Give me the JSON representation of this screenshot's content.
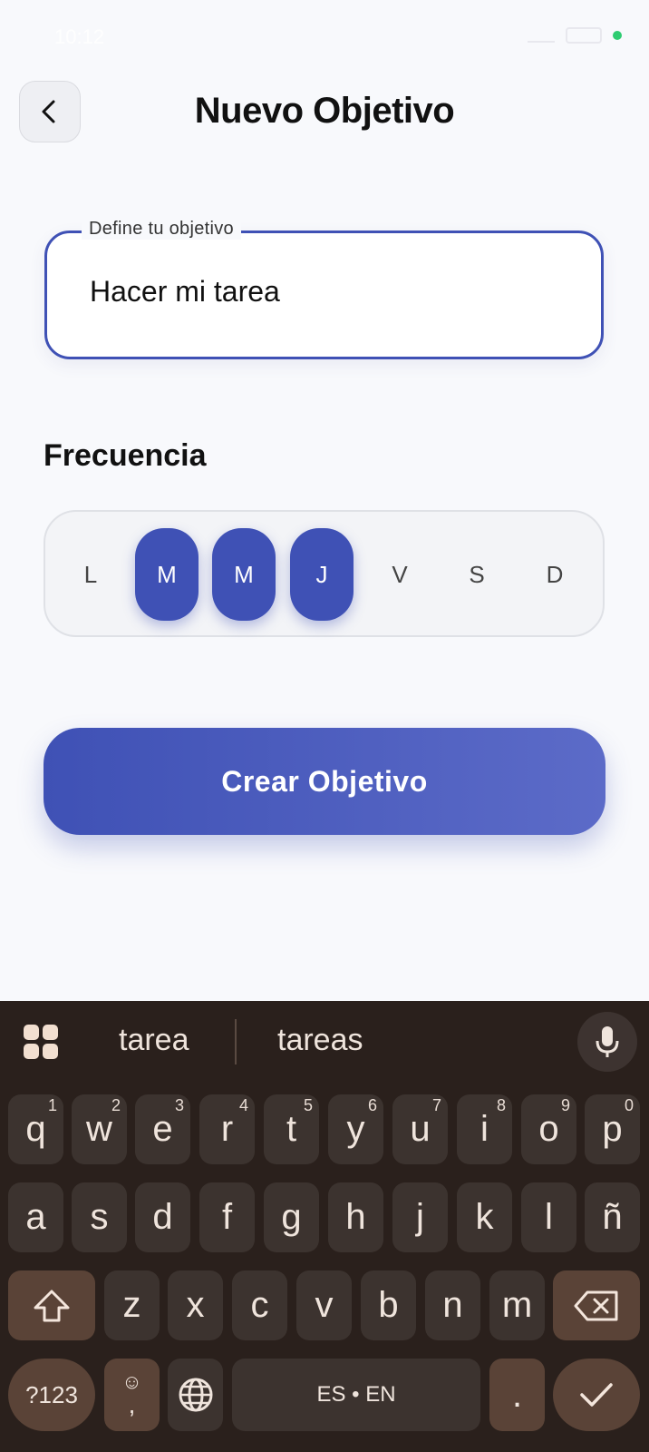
{
  "status_bar": {
    "time": "10:12"
  },
  "header": {
    "title": "Nuevo Objetivo"
  },
  "objective": {
    "label": "Define tu objetivo",
    "value": "Hacer mi tarea"
  },
  "frequency": {
    "title": "Frecuencia",
    "days": [
      {
        "label": "L",
        "selected": false
      },
      {
        "label": "M",
        "selected": true
      },
      {
        "label": "M",
        "selected": true
      },
      {
        "label": "J",
        "selected": true
      },
      {
        "label": "V",
        "selected": false
      },
      {
        "label": "S",
        "selected": false
      },
      {
        "label": "D",
        "selected": false
      }
    ]
  },
  "create_button": {
    "label": "Crear Objetivo"
  },
  "colors": {
    "accent": "#3f51b5",
    "background": "#f8f9fc",
    "keyboard": "#2a201c"
  },
  "keyboard": {
    "suggestions": [
      "tarea",
      "tareas"
    ],
    "row1": [
      {
        "k": "q",
        "h": "1"
      },
      {
        "k": "w",
        "h": "2"
      },
      {
        "k": "e",
        "h": "3"
      },
      {
        "k": "r",
        "h": "4"
      },
      {
        "k": "t",
        "h": "5"
      },
      {
        "k": "y",
        "h": "6"
      },
      {
        "k": "u",
        "h": "7"
      },
      {
        "k": "i",
        "h": "8"
      },
      {
        "k": "o",
        "h": "9"
      },
      {
        "k": "p",
        "h": "0"
      }
    ],
    "row2": [
      "a",
      "s",
      "d",
      "f",
      "g",
      "h",
      "j",
      "k",
      "l",
      "ñ"
    ],
    "row3": [
      "z",
      "x",
      "c",
      "v",
      "b",
      "n",
      "m"
    ],
    "symbols_label": "?123",
    "emoji_comma": ",",
    "space_label": "ES • EN",
    "period": "."
  }
}
